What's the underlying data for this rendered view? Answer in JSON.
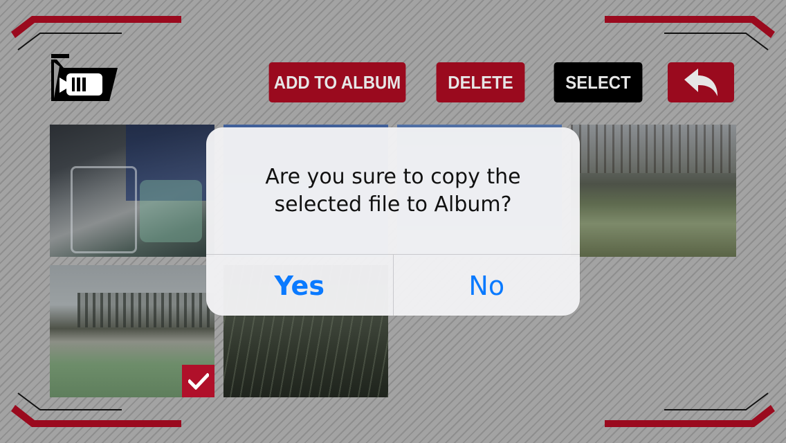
{
  "toolbar": {
    "add_to_album_label": "ADD TO ALBUM",
    "delete_label": "DELETE",
    "select_label": "SELECT"
  },
  "icons": {
    "folder": "folder-camera-icon",
    "back": "undo-arrow-icon",
    "checkmark": "checkmark-icon"
  },
  "colors": {
    "accent_red": "#9a0a1e",
    "select_black": "#000000",
    "dialog_button_blue": "#0a7aff"
  },
  "gallery": {
    "items": [
      {
        "scene": "indoor desk clutter",
        "selected": false
      },
      {
        "scene": "blurred blue",
        "selected": false
      },
      {
        "scene": "blurred blue",
        "selected": false
      },
      {
        "scene": "frosty grass field",
        "selected": false
      },
      {
        "scene": "frosty meadow and trees",
        "selected": true
      },
      {
        "scene": "grass close-up",
        "selected": false
      }
    ]
  },
  "dialog": {
    "message": "Are you sure to copy the\nselected file to Album?",
    "yes_label": "Yes",
    "no_label": "No"
  }
}
